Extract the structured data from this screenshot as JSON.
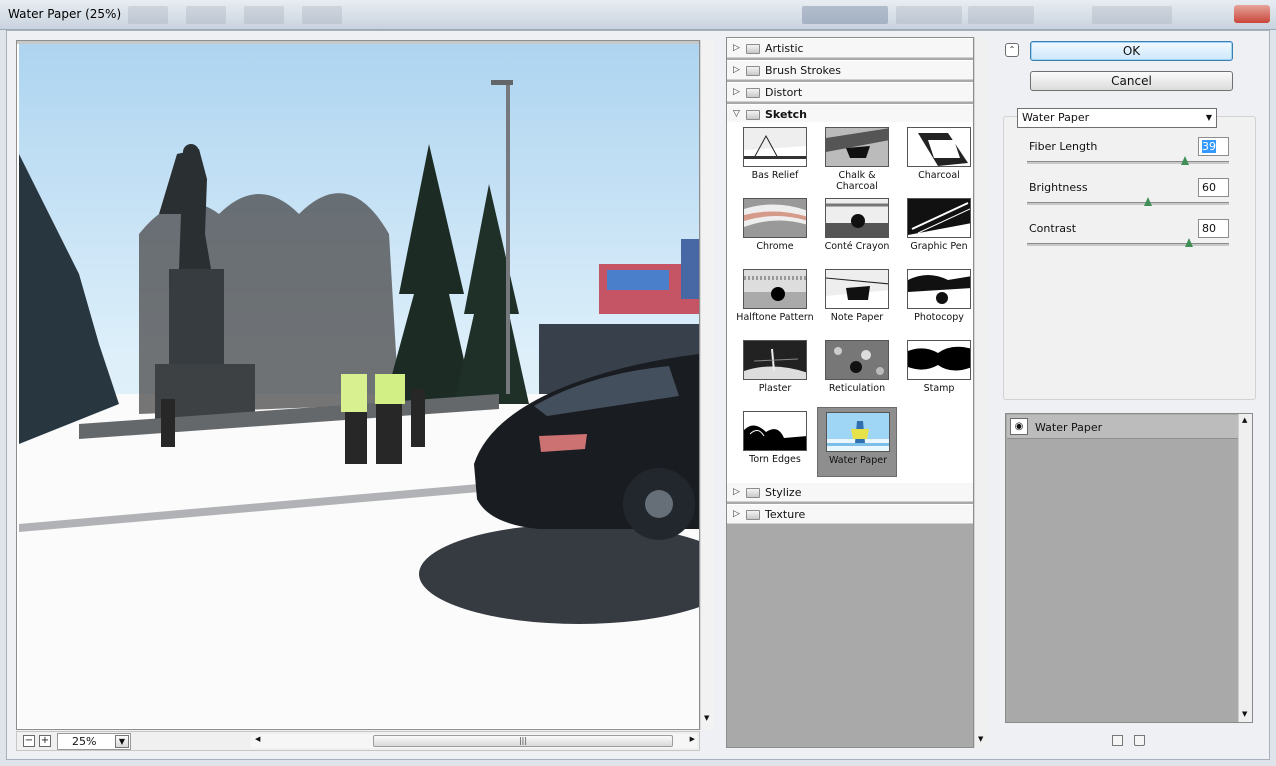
{
  "window": {
    "title": "Water Paper (25%)"
  },
  "preview": {
    "zoom": "25%",
    "zoom_out": "−",
    "zoom_in": "+",
    "scroll_grip": "|||"
  },
  "categories_top": [
    {
      "label": "Artistic",
      "expanded": false
    },
    {
      "label": "Brush Strokes",
      "expanded": false
    },
    {
      "label": "Distort",
      "expanded": false
    },
    {
      "label": "Sketch",
      "expanded": true
    }
  ],
  "categories_bottom": [
    {
      "label": "Stylize",
      "expanded": false
    },
    {
      "label": "Texture",
      "expanded": false
    }
  ],
  "sketch_filters": [
    {
      "label": "Bas Relief"
    },
    {
      "label": "Chalk & Charcoal"
    },
    {
      "label": "Charcoal"
    },
    {
      "label": "Chrome"
    },
    {
      "label": "Conté Crayon"
    },
    {
      "label": "Graphic Pen"
    },
    {
      "label": "Halftone Pattern"
    },
    {
      "label": "Note Paper"
    },
    {
      "label": "Photocopy"
    },
    {
      "label": "Plaster"
    },
    {
      "label": "Reticulation"
    },
    {
      "label": "Stamp"
    },
    {
      "label": "Torn Edges"
    },
    {
      "label": "Water Paper",
      "selected": true
    }
  ],
  "buttons": {
    "ok": "OK",
    "cancel": "Cancel"
  },
  "filter_select": {
    "value": "Water Paper"
  },
  "params": [
    {
      "label": "Fiber Length",
      "value": "39",
      "max": 50,
      "focused": true
    },
    {
      "label": "Brightness",
      "value": "60",
      "max": 100
    },
    {
      "label": "Contrast",
      "value": "80",
      "max": 100
    }
  ],
  "layers": [
    {
      "name": "Water Paper"
    }
  ],
  "icons": {
    "eye": "eye-icon",
    "new_layer": "new-layer-icon",
    "delete": "trash-icon"
  }
}
